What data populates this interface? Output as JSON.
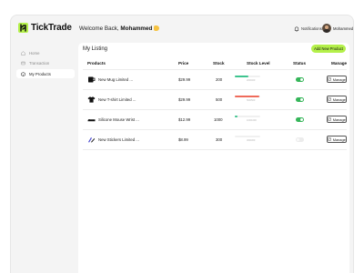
{
  "app": {
    "name": "TickTrade",
    "brand_color": "#b4f04a"
  },
  "header": {
    "welcome_prefix": "Welcome Back,",
    "user_first_name": "Mohammed",
    "notifications_label": "Notifications",
    "user_name": "Mohammed"
  },
  "sidebar": {
    "items": [
      {
        "label": "Home",
        "icon": "home-icon",
        "active": false
      },
      {
        "label": "Transaction",
        "icon": "transaction-icon",
        "active": false
      },
      {
        "label": "My Products",
        "icon": "products-icon",
        "active": true
      }
    ]
  },
  "listing": {
    "title": "My Listing",
    "add_button_label": "Add New Product",
    "columns": [
      "Products",
      "Price",
      "Stock",
      "Stock Level",
      "Status",
      "Manage"
    ],
    "rows": [
      {
        "name": "New Mug Limited ...",
        "price": "$29.99",
        "stock": "200",
        "stock_level_pct": 55,
        "stock_color": "#3ec48f",
        "stock_caption": "200/400",
        "status_on": true,
        "manage_label": "Manage",
        "image": "mug-image"
      },
      {
        "name": "New T-shirt Limited ...",
        "price": "$29.99",
        "stock": "500",
        "stock_level_pct": 95,
        "stock_color": "#ef6b5b",
        "stock_caption": "500/500",
        "status_on": true,
        "manage_label": "Manage",
        "image": "tshirt-image"
      },
      {
        "name": "Silicone Mouse Wrist ...",
        "price": "$12.99",
        "stock": "1000",
        "stock_level_pct": 12,
        "stock_color": "#3ec48f",
        "stock_caption": "100/1000",
        "status_on": true,
        "manage_label": "Manage",
        "image": "mouse-wrist-image"
      },
      {
        "name": "New Stickers Limited ...",
        "price": "$8.99",
        "stock": "300",
        "stock_level_pct": 0,
        "stock_color": "#d8d8d8",
        "stock_caption": "300/300",
        "status_on": false,
        "manage_label": "Manage",
        "image": "stickers-image"
      }
    ]
  }
}
